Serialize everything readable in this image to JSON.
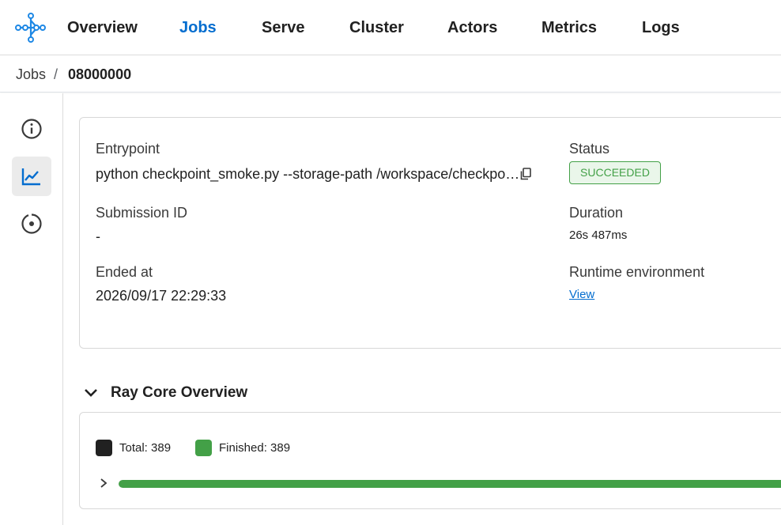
{
  "nav": {
    "items": [
      {
        "label": "Overview",
        "active": false
      },
      {
        "label": "Jobs",
        "active": true
      },
      {
        "label": "Serve",
        "active": false
      },
      {
        "label": "Cluster",
        "active": false
      },
      {
        "label": "Actors",
        "active": false
      },
      {
        "label": "Metrics",
        "active": false
      },
      {
        "label": "Logs",
        "active": false
      }
    ],
    "accent_color": "#036dcf"
  },
  "breadcrumb": {
    "parent": "Jobs",
    "separator": "/",
    "current": "08000000"
  },
  "side_rail": {
    "items": [
      {
        "icon": "info-icon",
        "active": false
      },
      {
        "icon": "line-chart-icon",
        "active": true
      },
      {
        "icon": "circle-dot-icon",
        "active": false
      }
    ]
  },
  "job_info": {
    "entrypoint": {
      "label": "Entrypoint",
      "value": "python checkpoint_smoke.py --storage-path /workspace/checkpo…"
    },
    "status": {
      "label": "Status",
      "value": "SUCCEEDED",
      "color": "#43a047"
    },
    "submission_id": {
      "label": "Submission ID",
      "value": "-"
    },
    "duration": {
      "label": "Duration",
      "value": "26s 487ms"
    },
    "ended_at": {
      "label": "Ended at",
      "value": "2026/09/17 22:29:33"
    },
    "runtime_env": {
      "label": "Runtime environment",
      "link": "View"
    }
  },
  "ray_core": {
    "title": "Ray Core Overview",
    "legend": [
      {
        "label": "Total: 389",
        "color": "#212121"
      },
      {
        "label": "Finished: 389",
        "color": "#43a047"
      }
    ],
    "progress_fraction": 1.0
  }
}
